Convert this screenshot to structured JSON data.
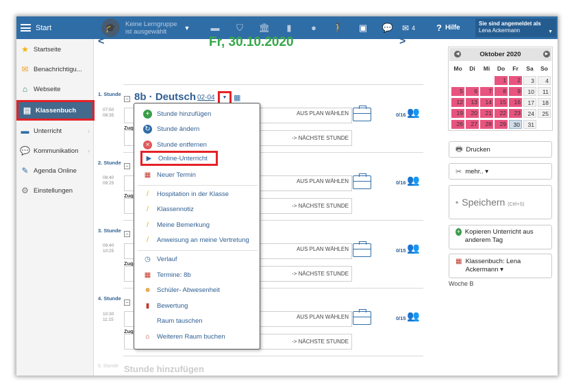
{
  "topbar": {
    "start": "Start",
    "group_line1": "Keine Lerngruppe",
    "group_line2": "ist ausgewählt",
    "mail_count": "4",
    "help": "Hilfe",
    "user_label": "Sie sind angemeldet als",
    "user_name": "Lena Ackermann"
  },
  "sidebar": {
    "items": [
      {
        "label": "Startseite"
      },
      {
        "label": "Benachrichtigu..."
      },
      {
        "label": "Webseite"
      },
      {
        "label": "Klassenbuch"
      },
      {
        "label": "Unterricht"
      },
      {
        "label": "Kommunikation"
      },
      {
        "label": "Agenda Online"
      },
      {
        "label": "Einstellungen"
      }
    ]
  },
  "main": {
    "date": "Fr, 30.10.2020",
    "lessons": [
      {
        "label": "1. Stunde",
        "time_start": "07:50",
        "time_end": "08:35",
        "count": "0/16"
      },
      {
        "label": "2. Stunde",
        "time_start": "08:40",
        "time_end": "09:25",
        "count": "0/16"
      },
      {
        "label": "3. Stunde",
        "time_start": "09:40",
        "time_end": "10:25",
        "count": "0/15"
      },
      {
        "label": "4. Stunde",
        "time_start": "10:30",
        "time_end": "11:15",
        "count": "0/15"
      }
    ],
    "subject": "8b · Deutsch",
    "subject_code": "02-04",
    "plan_btn": "AUS PLAN WÄHLEN",
    "next_btn": "-> NÄCHSTE STUNDE",
    "zug": "Zug",
    "add_label": "5. Stunde",
    "add_text": "Stunde hinzufügen"
  },
  "menu": {
    "items": [
      "Stunde hinzufügen",
      "Stunde ändern",
      "Stunde entfernen",
      "Online-Unterricht",
      "Neuer Termin",
      "Hospitation in der Klasse",
      "Klassennotiz",
      "Meine Bemerkung",
      "Anweisung an meine Vertretung",
      "Verlauf",
      "Termine: 8b",
      "Schüler- Abwesenheit",
      "Bewertung",
      "Raum tauschen",
      "Weiteren Raum buchen"
    ]
  },
  "calendar": {
    "month": "Oktober 2020",
    "weekdays": [
      "Mo",
      "Di",
      "Mi",
      "Do",
      "Fr",
      "Sa",
      "So"
    ],
    "weeks": [
      [
        "",
        "",
        "",
        "1",
        "2",
        "3",
        "4"
      ],
      [
        "5",
        "6",
        "7",
        "8",
        "9",
        "10",
        "11"
      ],
      [
        "12",
        "13",
        "14",
        "15",
        "16",
        "17",
        "18"
      ],
      [
        "19",
        "20",
        "21",
        "22",
        "23",
        "24",
        "25"
      ],
      [
        "26",
        "27",
        "28",
        "29",
        "30",
        "31",
        ""
      ]
    ]
  },
  "right": {
    "print": "Drucken",
    "more": "mehr.. ▾",
    "save": "Speichern",
    "save_shortcut": "(Ctrl+S)",
    "copy": "Kopieren Unterricht aus anderem Tag",
    "classbook": "Klassenbuch: Lena Ackermann ▾",
    "week": "Woche B"
  }
}
